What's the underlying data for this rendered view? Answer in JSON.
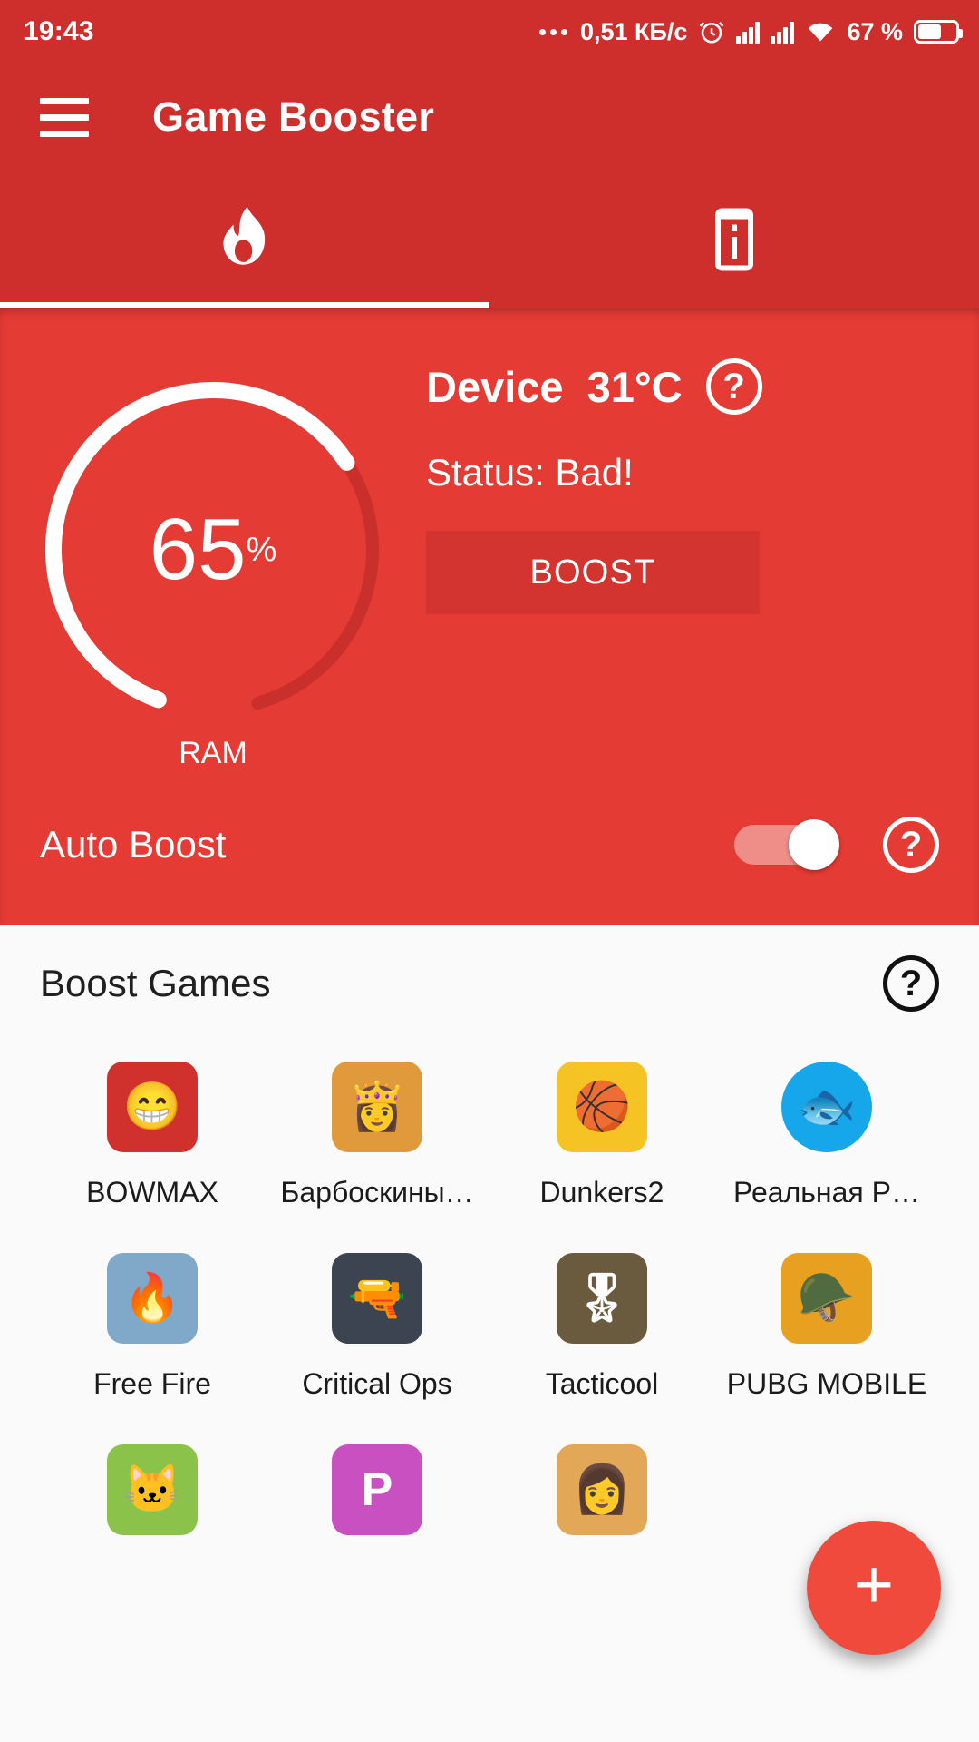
{
  "status_bar": {
    "time": "19:43",
    "network_speed": "0,51 КБ/с",
    "battery_percent": "67 %",
    "icons": [
      "more-dots-icon",
      "alarm-icon",
      "signal-sim1-icon",
      "signal-sim2-icon",
      "wifi-icon",
      "battery-icon"
    ]
  },
  "toolbar": {
    "menu_icon": "hamburger-menu-icon",
    "title": "Game Booster"
  },
  "tabs": [
    {
      "name": "boost-tab",
      "icon": "flame-icon",
      "active": true
    },
    {
      "name": "device-info-tab",
      "icon": "phone-info-icon",
      "active": false
    }
  ],
  "panel": {
    "gauge": {
      "value": "65",
      "unit": "%",
      "label": "RAM",
      "percent": 65,
      "track_color": "#C9302C",
      "progress_color": "#FFFFFF"
    },
    "device_label": "Device",
    "device_temp": "31°C",
    "device_help_icon": "question-mark-icon",
    "status": "Status: Bad!",
    "boost_button": "BOOST",
    "auto_boost_label": "Auto Boost",
    "auto_boost_on": true,
    "auto_boost_help_icon": "question-mark-icon",
    "background_color": "#E43B34"
  },
  "games_section": {
    "title": "Boost Games",
    "help_icon": "question-mark-icon",
    "games": [
      {
        "name": "BOWMAX",
        "icon": "bowmax-app-icon",
        "bg": "#D0312C",
        "glyph": "😁",
        "shape": "square"
      },
      {
        "name": "Барбоскины…",
        "icon": "barboskiny-app-icon",
        "bg": "#E09A3C",
        "glyph": "👸",
        "shape": "square"
      },
      {
        "name": "Dunkers2",
        "icon": "dunkers2-app-icon",
        "bg": "#F6C324",
        "glyph": "🏀",
        "shape": "square"
      },
      {
        "name": "Реальная Р…",
        "icon": "realnaya-rybalka-icon",
        "bg": "#16A6EA",
        "glyph": "🐟",
        "shape": "round"
      },
      {
        "name": "Free Fire",
        "icon": "free-fire-app-icon",
        "bg": "#7FA8C9",
        "glyph": "🔥",
        "shape": "square"
      },
      {
        "name": "Critical Ops",
        "icon": "critical-ops-app-icon",
        "bg": "#3B4450",
        "glyph": "🔫",
        "shape": "square"
      },
      {
        "name": "Tacticool",
        "icon": "tacticool-app-icon",
        "bg": "#6B5B3E",
        "glyph": "🎖",
        "shape": "square"
      },
      {
        "name": "PUBG MOBILE",
        "icon": "pubg-mobile-app-icon",
        "bg": "#E8A020",
        "glyph": "🪖",
        "shape": "square"
      },
      {
        "name": "",
        "icon": "talking-tom-2-app-icon",
        "bg": "#8BC34A",
        "glyph": "🐱",
        "shape": "square"
      },
      {
        "name": "",
        "icon": "picsart-app-icon",
        "bg": "#C850C0",
        "glyph": "P",
        "shape": "square"
      },
      {
        "name": "",
        "icon": "sniper-girl-app-icon",
        "bg": "#E3A857",
        "glyph": "👩",
        "shape": "square"
      }
    ]
  },
  "fab": {
    "label": "+",
    "icon": "plus-icon",
    "color": "#F04A3C"
  }
}
